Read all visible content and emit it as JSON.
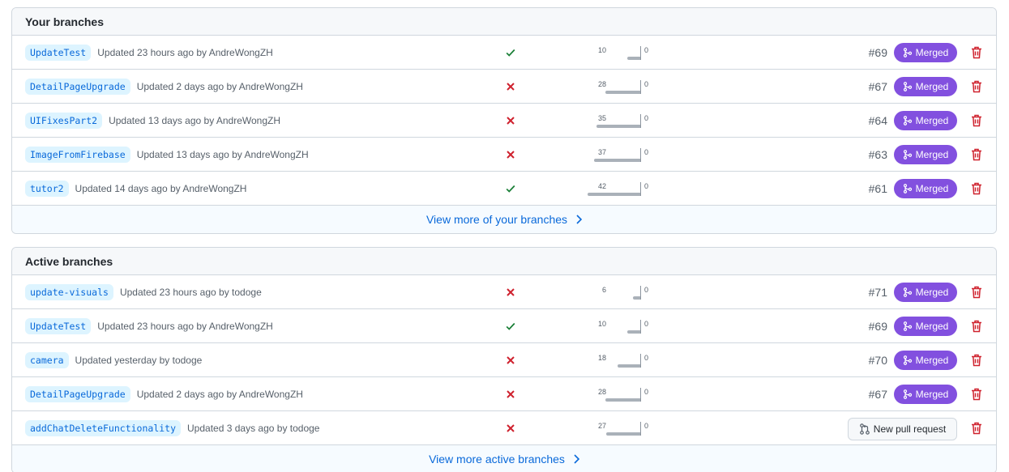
{
  "your_branches": {
    "title": "Your branches",
    "rows": [
      {
        "name": "UpdateTest",
        "updated": "Updated 23 hours ago by AndreWongZH",
        "status": "check",
        "behind": 10,
        "ahead": 0,
        "pr": "#69",
        "action": "Merged"
      },
      {
        "name": "DetailPageUpgrade",
        "updated": "Updated 2 days ago by AndreWongZH",
        "status": "x",
        "behind": 28,
        "ahead": 0,
        "pr": "#67",
        "action": "Merged"
      },
      {
        "name": "UIFixesPart2",
        "updated": "Updated 13 days ago by AndreWongZH",
        "status": "x",
        "behind": 35,
        "ahead": 0,
        "pr": "#64",
        "action": "Merged"
      },
      {
        "name": "ImageFromFirebase",
        "updated": "Updated 13 days ago by AndreWongZH",
        "status": "x",
        "behind": 37,
        "ahead": 0,
        "pr": "#63",
        "action": "Merged"
      },
      {
        "name": "tutor2",
        "updated": "Updated 14 days ago by AndreWongZH",
        "status": "check",
        "behind": 42,
        "ahead": 0,
        "pr": "#61",
        "action": "Merged"
      }
    ],
    "more_label": "View more of your branches"
  },
  "active_branches": {
    "title": "Active branches",
    "rows": [
      {
        "name": "update-visuals",
        "updated": "Updated 23 hours ago by todoge",
        "status": "x",
        "behind": 6,
        "ahead": 0,
        "pr": "#71",
        "action": "Merged"
      },
      {
        "name": "UpdateTest",
        "updated": "Updated 23 hours ago by AndreWongZH",
        "status": "check",
        "behind": 10,
        "ahead": 0,
        "pr": "#69",
        "action": "Merged"
      },
      {
        "name": "camera",
        "updated": "Updated yesterday by todoge",
        "status": "x",
        "behind": 18,
        "ahead": 0,
        "pr": "#70",
        "action": "Merged"
      },
      {
        "name": "DetailPageUpgrade",
        "updated": "Updated 2 days ago by AndreWongZH",
        "status": "x",
        "behind": 28,
        "ahead": 0,
        "pr": "#67",
        "action": "Merged"
      },
      {
        "name": "addChatDeleteFunctionality",
        "updated": "Updated 3 days ago by todoge",
        "status": "x",
        "behind": 27,
        "ahead": 0,
        "pr": "",
        "action": "New pull request"
      }
    ],
    "more_label": "View more active branches"
  },
  "colors": {
    "merged": "#8250df",
    "success": "#1a7f37",
    "danger": "#cf222e",
    "link": "#0969da"
  },
  "icons": {
    "check": "check-icon",
    "x": "x-icon",
    "merged": "git-merge-icon",
    "new_pr": "git-pull-request-icon",
    "delete": "trash-icon",
    "more": "chevron-right-icon"
  }
}
